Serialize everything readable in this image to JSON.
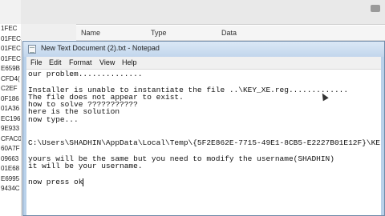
{
  "registry": {
    "tree_items": [
      "1FEC",
      "01FEC",
      "01FEC",
      "01FEC",
      "E659B",
      "CFD4(",
      "C2EF",
      "0F186",
      "01A36",
      "EC196",
      "9E933",
      "CFAC0",
      "60A7F",
      "09663",
      "01E68",
      "E6995",
      "9434C"
    ],
    "columns": {
      "name": "Name",
      "type": "Type",
      "data": "Data"
    }
  },
  "notepad": {
    "title": "New Text Document (2).txt - Notepad",
    "menu": [
      "File",
      "Edit",
      "Format",
      "View",
      "Help"
    ],
    "lines": [
      "our problem..............",
      "",
      "Installer is unable to instantiate the file ..\\KEY_XE.reg.............",
      "The file does not appear to exist.",
      "how to solve ???????????",
      "here is the solution",
      "now type...",
      "",
      "",
      "C:\\Users\\SHADHIN\\AppData\\Local\\Temp\\{5F2E862E-7715-49E1-8CB5-E2227B01E12F}\\KE",
      "",
      "yours will be the same but you need to modify the username(SHADHIN)",
      "it will be your username.",
      "",
      "now press ok"
    ]
  }
}
